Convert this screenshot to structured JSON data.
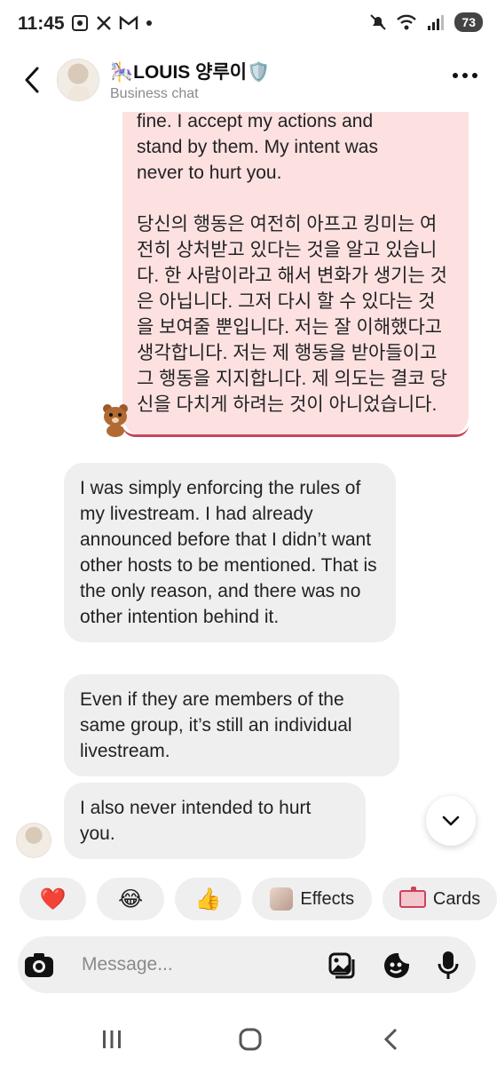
{
  "status_bar": {
    "time": "11:45",
    "battery": "73",
    "left_icons": [
      "screenshot-icon",
      "x-icon",
      "gmail-icon",
      "dot-icon"
    ],
    "right_icons": [
      "mute-icon",
      "wifi-icon",
      "signal-icon"
    ]
  },
  "header": {
    "contact_name": "🎠LOUIS 양루이🛡️",
    "subtitle": "Business chat"
  },
  "messages": {
    "outgoing_en": "fine. I accept my actions and\nstand by them. My intent was\nnever to hurt you.",
    "outgoing_ko": "당신의 행동은 여전히 아프고 킹미는 여\n전히 상처받고 있다는 것을 알고 있습니\n다. 한 사람이라고 해서 변화가 생기는 것\n은 아닙니다. 그저 다시 할 수 있다는 것\n을 보여줄 뿐입니다. 저는 잘 이해했다고\n생각합니다. 저는 제 행동을 받아들이고\n그 행동을 지지합니다. 제 의도는 결코 당\n신을 다치게 하려는 것이 아니었습니다.",
    "incoming": [
      "I was simply enforcing the rules of my livestream. I had already announced before that I didn’t want other hosts to be mentioned. That is the only reason, and there was no other intention behind it.",
      "Even if they are members of the same group, it’s still an individual livestream.",
      "I also never intended to hurt you."
    ]
  },
  "reactions": {
    "heart": "❤️",
    "laugh": "😂",
    "thumbs": "👍",
    "effects_label": "Effects",
    "cards_label": "Cards"
  },
  "composer": {
    "placeholder": "Message..."
  },
  "colors": {
    "outgoing_bubble": "#fde1e1",
    "outgoing_accent": "#c9455b",
    "incoming_bubble": "#efefef"
  }
}
